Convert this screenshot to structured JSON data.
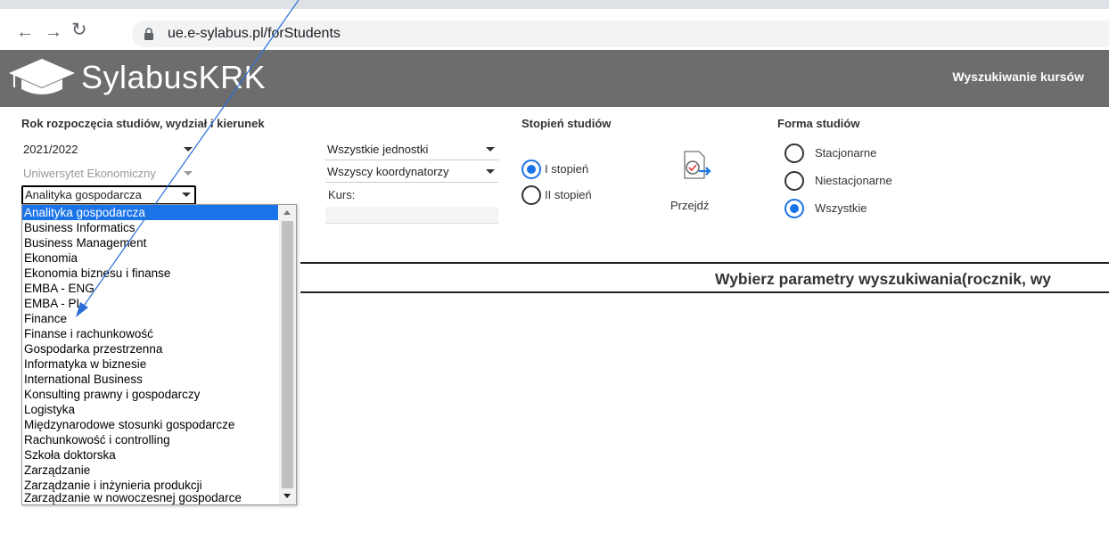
{
  "browser": {
    "back_icon": "arrow-left-icon",
    "forward_icon": "arrow-right-icon",
    "reload_icon": "reload-icon",
    "url": "ue.e-sylabus.pl/forStudents"
  },
  "header": {
    "logo_text": "SylabusKRK",
    "nav_link": "Wyszukiwanie kursów"
  },
  "filters": {
    "section_label": "Rok rozpoczęcia studiów, wydział i kierunek",
    "year": "2021/2022",
    "university": "Uniwersytet Ekonomiczny",
    "program": "Analityka gospodarcza",
    "units": "Wszystkie jednostki",
    "coordinators": "Wszyscy koordynatorzy",
    "course_label": "Kurs:",
    "course_value": ""
  },
  "degree": {
    "label": "Stopień studiów",
    "options": [
      {
        "label": "I stopień",
        "selected": true
      },
      {
        "label": "II stopień",
        "selected": false
      }
    ]
  },
  "go": {
    "label": "Przejdź"
  },
  "form": {
    "label": "Forma studiów",
    "options": [
      {
        "label": "Stacjonarne",
        "selected": false
      },
      {
        "label": "Niestacjonarne",
        "selected": false
      },
      {
        "label": "Wszystkie",
        "selected": true
      }
    ]
  },
  "dropdown": {
    "options": [
      "Analityka gospodarcza",
      "Business Informatics",
      "Business Management",
      "Ekonomia",
      "Ekonomia biznesu i finanse",
      "EMBA - ENG",
      "EMBA - PL",
      "Finance",
      "Finanse i rachunkowość",
      "Gospodarka przestrzenna",
      "Informatyka w biznesie",
      "International Business",
      "Konsulting prawny i gospodarczy",
      "Logistyka",
      "Międzynarodowe stosunki gospodarcze",
      "Rachunkowość i controlling",
      "Szkoła doktorska",
      "Zarządzanie",
      "Zarządzanie i inżynieria produkcji",
      "Zarządzanie w nowoczesnej gospodarce"
    ],
    "selected_index": 0
  },
  "results": {
    "title": "Wybierz parametry wyszukiwania(rocznik, wy"
  },
  "colors": {
    "banner": "#6d6d6d",
    "accent": "#1a73e8",
    "annotation": "#2a6fd6"
  }
}
